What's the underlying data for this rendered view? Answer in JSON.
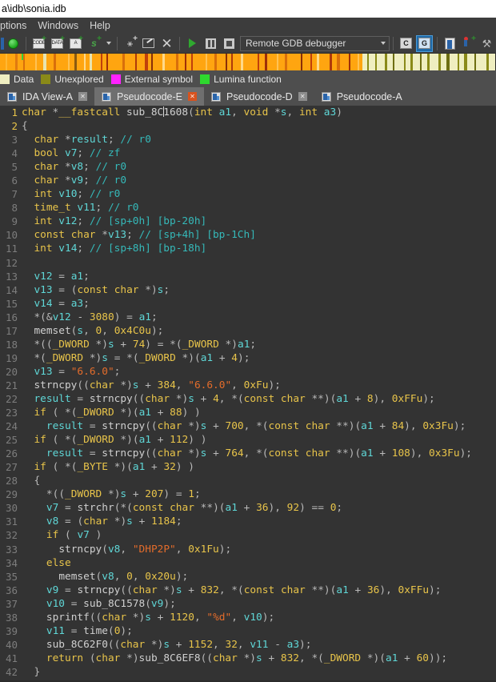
{
  "window": {
    "title": "a\\idb\\sonia.idb"
  },
  "menubar": {
    "items": [
      {
        "label": "ptions"
      },
      {
        "label": "Windows"
      },
      {
        "label": "Help"
      }
    ]
  },
  "toolbar": {
    "debugger_selected": "Remote GDB debugger",
    "icons": [
      "green-status-circle-icon",
      "make-code-icon",
      "make-data-icon",
      "make-string-icon",
      "make-struct-icon",
      "dropdown-arrow-icon",
      "jump-to-xref-icon",
      "edit-function-icon",
      "undefine-icon",
      "run-icon",
      "pause-icon",
      "stop-icon",
      "step-into-icon",
      "step-over-icon",
      "breakpoint-list-icon",
      "add-breakpoint-icon",
      "tracing-icon"
    ]
  },
  "legend": {
    "items": [
      {
        "label": "Data",
        "color": "#efeec0"
      },
      {
        "label": "Unexplored",
        "color": "#8a8a18"
      },
      {
        "label": "External symbol",
        "color": "#ff22ff"
      },
      {
        "label": "Lumina function",
        "color": "#2ed92e"
      }
    ]
  },
  "navband": {
    "marker_position_px": 27,
    "segments": [
      {
        "w": 6,
        "c": "#ffa510"
      },
      {
        "w": 2,
        "c": "#ffb733"
      },
      {
        "w": 9,
        "c": "#ffa510"
      },
      {
        "w": 3,
        "c": "#e07a10"
      },
      {
        "w": 6,
        "c": "#ffa510"
      },
      {
        "w": 2,
        "c": "#d86f0b"
      },
      {
        "w": 12,
        "c": "#ffa510"
      },
      {
        "w": 2,
        "c": "#ffc254"
      },
      {
        "w": 7,
        "c": "#ffa510"
      },
      {
        "w": 3,
        "c": "#e8e4b0"
      },
      {
        "w": 9,
        "c": "#ffa510"
      },
      {
        "w": 2,
        "c": "#d86f0b"
      },
      {
        "w": 14,
        "c": "#ffa510"
      },
      {
        "w": 2,
        "c": "#ffc254"
      },
      {
        "w": 5,
        "c": "#ffa510"
      },
      {
        "w": 3,
        "c": "#8a5a10"
      },
      {
        "w": 8,
        "c": "#ffa510"
      },
      {
        "w": 2,
        "c": "#ffd98a"
      },
      {
        "w": 4,
        "c": "#ffa510"
      },
      {
        "w": 3,
        "c": "#e8e4b0"
      },
      {
        "w": 10,
        "c": "#ffa510"
      },
      {
        "w": 2,
        "c": "#c0400b"
      },
      {
        "w": 4,
        "c": "#ffa510"
      },
      {
        "w": 2,
        "c": "#9e2f08"
      },
      {
        "w": 16,
        "c": "#ffa510"
      },
      {
        "w": 3,
        "c": "#d86f0b"
      },
      {
        "w": 12,
        "c": "#ffa510"
      },
      {
        "w": 2,
        "c": "#b03a0a"
      },
      {
        "w": 9,
        "c": "#ffa510"
      },
      {
        "w": 3,
        "c": "#c0400b"
      },
      {
        "w": 4,
        "c": "#ffa510"
      },
      {
        "w": 2,
        "c": "#8a2f08"
      },
      {
        "w": 11,
        "c": "#ffa510"
      },
      {
        "w": 2,
        "c": "#ffd98a"
      },
      {
        "w": 13,
        "c": "#ffa510"
      },
      {
        "w": 3,
        "c": "#d86f0b"
      },
      {
        "w": 7,
        "c": "#ffa510"
      },
      {
        "w": 2,
        "c": "#9e2f08"
      },
      {
        "w": 5,
        "c": "#ffa510"
      },
      {
        "w": 2,
        "c": "#c0400b"
      },
      {
        "w": 14,
        "c": "#ffa510"
      },
      {
        "w": 2,
        "c": "#ffc254"
      },
      {
        "w": 8,
        "c": "#ffa510"
      },
      {
        "w": 3,
        "c": "#d86f0b"
      },
      {
        "w": 10,
        "c": "#ffa510"
      },
      {
        "w": 2,
        "c": "#8a2f08"
      },
      {
        "w": 4,
        "c": "#ffa510"
      },
      {
        "w": 2,
        "c": "#b03a0a"
      },
      {
        "w": 9,
        "c": "#ffa510"
      },
      {
        "w": 3,
        "c": "#ffd98a"
      },
      {
        "w": 16,
        "c": "#ffa510"
      },
      {
        "w": 2,
        "c": "#c0400b"
      },
      {
        "w": 6,
        "c": "#ffa510"
      },
      {
        "w": 3,
        "c": "#9e2f08"
      },
      {
        "w": 11,
        "c": "#ffa510"
      },
      {
        "w": 2,
        "c": "#ffc254"
      },
      {
        "w": 7,
        "c": "#ffa510"
      },
      {
        "w": 3,
        "c": "#d86f0b"
      },
      {
        "w": 15,
        "c": "#ffa510"
      },
      {
        "w": 2,
        "c": "#8a2f08"
      },
      {
        "w": 9,
        "c": "#ffa510"
      },
      {
        "w": 2,
        "c": "#c0400b"
      },
      {
        "w": 5,
        "c": "#ffa510"
      },
      {
        "w": 3,
        "c": "#ffd98a"
      },
      {
        "w": 12,
        "c": "#ffa510"
      },
      {
        "w": 2,
        "c": "#b03a0a"
      },
      {
        "w": 6,
        "c": "#ffa510"
      },
      {
        "w": 3,
        "c": "#d86f0b"
      },
      {
        "w": 10,
        "c": "#ffa510"
      },
      {
        "w": 2,
        "c": "#9e2f08"
      },
      {
        "w": 8,
        "c": "#ffa510"
      },
      {
        "w": 2,
        "c": "#ffc254"
      },
      {
        "w": 4,
        "c": "#ffa510"
      },
      {
        "w": 5,
        "c": "#efeec0"
      },
      {
        "w": 2,
        "c": "#8a8a18"
      },
      {
        "w": 7,
        "c": "#efeec0"
      },
      {
        "w": 2,
        "c": "#8a8a18"
      },
      {
        "w": 9,
        "c": "#efeec0"
      },
      {
        "w": 3,
        "c": "#8a8a18"
      },
      {
        "w": 6,
        "c": "#efeec0"
      },
      {
        "w": 2,
        "c": "#6e6e12"
      },
      {
        "w": 11,
        "c": "#efeec0"
      },
      {
        "w": 2,
        "c": "#8a8a18"
      },
      {
        "w": 5,
        "c": "#efeec0"
      },
      {
        "w": 3,
        "c": "#8a8a18"
      },
      {
        "w": 8,
        "c": "#efeec0"
      },
      {
        "w": 2,
        "c": "#6e6e12"
      },
      {
        "w": 6,
        "c": "#efeec0"
      },
      {
        "w": 3,
        "c": "#8a8a18"
      },
      {
        "w": 10,
        "c": "#efeec0"
      },
      {
        "w": 2,
        "c": "#8a8a18"
      },
      {
        "w": 7,
        "c": "#efeec0"
      },
      {
        "w": 3,
        "c": "#6e6e12"
      },
      {
        "w": 9,
        "c": "#efeec0"
      },
      {
        "w": 2,
        "c": "#8a8a18"
      },
      {
        "w": 6,
        "c": "#efeec0"
      },
      {
        "w": 3,
        "c": "#8a8a18"
      },
      {
        "w": 8,
        "c": "#efeec0"
      },
      {
        "w": 2,
        "c": "#6e6e12"
      },
      {
        "w": 12,
        "c": "#efeec0"
      },
      {
        "w": 3,
        "c": "#8a8a18"
      },
      {
        "w": 7,
        "c": "#efeec0"
      }
    ]
  },
  "tabs": [
    {
      "label": "IDA View-A",
      "active": false,
      "closable": true
    },
    {
      "label": "Pseudocode-E",
      "active": true,
      "closable": true
    },
    {
      "label": "Pseudocode-D",
      "active": false,
      "closable": true
    },
    {
      "label": "Pseudocode-A",
      "active": false,
      "closable": false
    }
  ],
  "editor": {
    "cursor_line": 1,
    "highlighted_line_numbers": [
      1,
      2
    ],
    "lines": [
      {
        "n": 1,
        "text": "char *__fastcall sub_8C1608(int a1, void *s, int a3)"
      },
      {
        "n": 2,
        "text": "{"
      },
      {
        "n": 3,
        "text": "  char *result; // r0"
      },
      {
        "n": 4,
        "text": "  bool v7; // zf"
      },
      {
        "n": 5,
        "text": "  char *v8; // r0"
      },
      {
        "n": 6,
        "text": "  char *v9; // r0"
      },
      {
        "n": 7,
        "text": "  int v10; // r0"
      },
      {
        "n": 8,
        "text": "  time_t v11; // r0"
      },
      {
        "n": 9,
        "text": "  int v12; // [sp+0h] [bp-20h]"
      },
      {
        "n": 10,
        "text": "  const char *v13; // [sp+4h] [bp-1Ch]"
      },
      {
        "n": 11,
        "text": "  int v14; // [sp+8h] [bp-18h]"
      },
      {
        "n": 12,
        "text": ""
      },
      {
        "n": 13,
        "text": "  v12 = a1;"
      },
      {
        "n": 14,
        "text": "  v13 = (const char *)s;"
      },
      {
        "n": 15,
        "text": "  v14 = a3;"
      },
      {
        "n": 16,
        "text": "  *(&v12 - 3080) = a1;"
      },
      {
        "n": 17,
        "text": "  memset(s, 0, 0x4C0u);"
      },
      {
        "n": 18,
        "text": "  *((_DWORD *)s + 74) = *(_DWORD *)a1;"
      },
      {
        "n": 19,
        "text": "  *(_DWORD *)s = *(_DWORD *)(a1 + 4);"
      },
      {
        "n": 20,
        "text": "  v13 = \"6.6.0\";"
      },
      {
        "n": 21,
        "text": "  strncpy((char *)s + 384, \"6.6.0\", 0xFu);"
      },
      {
        "n": 22,
        "text": "  result = strncpy((char *)s + 4, *(const char **)(a1 + 8), 0xFFu);"
      },
      {
        "n": 23,
        "text": "  if ( *(_DWORD *)(a1 + 88) )"
      },
      {
        "n": 24,
        "text": "    result = strncpy((char *)s + 700, *(const char **)(a1 + 84), 0x3Fu);"
      },
      {
        "n": 25,
        "text": "  if ( *(_DWORD *)(a1 + 112) )"
      },
      {
        "n": 26,
        "text": "    result = strncpy((char *)s + 764, *(const char **)(a1 + 108), 0x3Fu);"
      },
      {
        "n": 27,
        "text": "  if ( *(_BYTE *)(a1 + 32) )"
      },
      {
        "n": 28,
        "text": "  {"
      },
      {
        "n": 29,
        "text": "    *((_DWORD *)s + 207) = 1;"
      },
      {
        "n": 30,
        "text": "    v7 = strchr(*(const char **)(a1 + 36), 92) == 0;"
      },
      {
        "n": 31,
        "text": "    v8 = (char *)s + 1184;"
      },
      {
        "n": 32,
        "text": "    if ( v7 )"
      },
      {
        "n": 33,
        "text": "      strncpy(v8, \"DHP2P\", 0x1Fu);"
      },
      {
        "n": 34,
        "text": "    else"
      },
      {
        "n": 35,
        "text": "      memset(v8, 0, 0x20u);"
      },
      {
        "n": 36,
        "text": "    v9 = strncpy((char *)s + 832, *(const char **)(a1 + 36), 0xFFu);"
      },
      {
        "n": 37,
        "text": "    v10 = sub_8C1578(v9);"
      },
      {
        "n": 38,
        "text": "    sprintf((char *)s + 1120, \"%d\", v10);"
      },
      {
        "n": 39,
        "text": "    v11 = time(0);"
      },
      {
        "n": 40,
        "text": "    sub_8C62F0((char *)s + 1152, 32, v11 - a3);"
      },
      {
        "n": 41,
        "text": "    return (char *)sub_8C6EF8((char *)s + 832, *(_DWORD *)(a1 + 60));"
      },
      {
        "n": 42,
        "text": "  }"
      }
    ]
  }
}
